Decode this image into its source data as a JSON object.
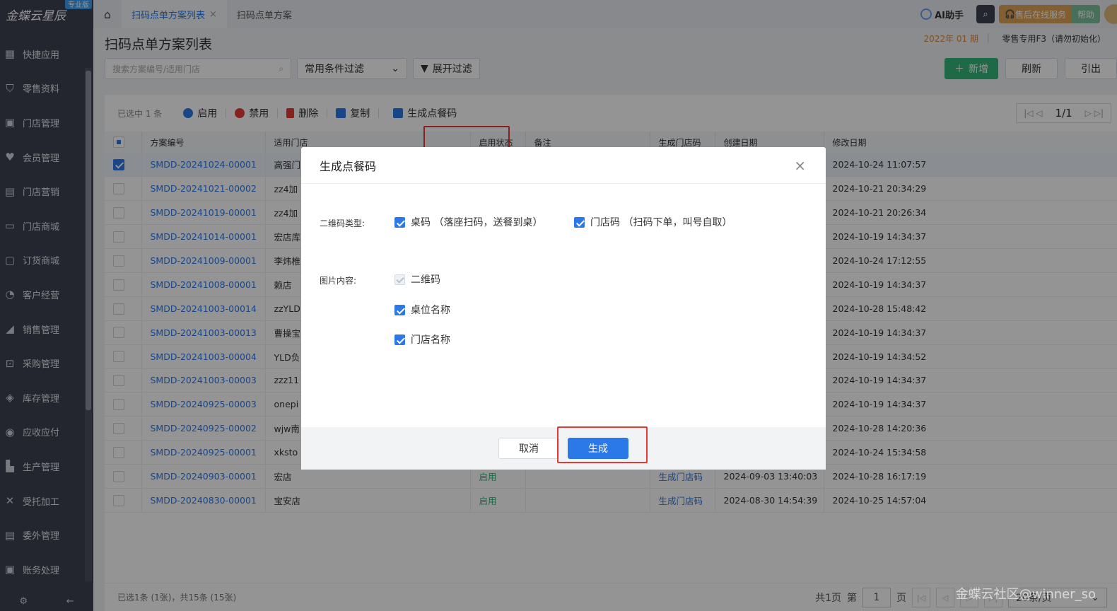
{
  "app": {
    "logo": "金蝶云星辰",
    "edition": "专业版"
  },
  "sidebar": {
    "items": [
      {
        "label": "快捷应用",
        "icon": "grid-icon"
      },
      {
        "label": "零售资料",
        "icon": "basket-icon"
      },
      {
        "label": "门店管理",
        "icon": "store-icon"
      },
      {
        "label": "会员管理",
        "icon": "heart-icon"
      },
      {
        "label": "门店营销",
        "icon": "bag-icon"
      },
      {
        "label": "门店商城",
        "icon": "shop-icon"
      },
      {
        "label": "订货商城",
        "icon": "cart-bag-icon"
      },
      {
        "label": "客户经营",
        "icon": "customer-icon"
      },
      {
        "label": "销售管理",
        "icon": "chart-icon"
      },
      {
        "label": "采购管理",
        "icon": "cart-icon"
      },
      {
        "label": "库存管理",
        "icon": "box-icon"
      },
      {
        "label": "应收应付",
        "icon": "money-icon"
      },
      {
        "label": "生产管理",
        "icon": "factory-icon"
      },
      {
        "label": "受托加工",
        "icon": "tools-icon"
      },
      {
        "label": "委外管理",
        "icon": "outsource-icon"
      },
      {
        "label": "账务处理",
        "icon": "ledger-icon"
      }
    ]
  },
  "topbar": {
    "tabs": [
      {
        "label": "扫码点单方案列表",
        "active": true
      },
      {
        "label": "扫码点单方案",
        "active": false
      }
    ],
    "ai": "AI助手",
    "service": "售后在线服务",
    "help": "帮助"
  },
  "page": {
    "title": "扫码点单方案列表",
    "period": "2022年 01 期",
    "org": "零售专用F3（请勿初始化）",
    "search_placeholder": "搜索方案编号/适用门店",
    "filter_select": "常用条件过滤",
    "expand_filter": "展开过滤",
    "btn_new": "新增",
    "btn_refresh": "刷新",
    "btn_export": "引出"
  },
  "toolbar": {
    "selected": "已选中 1 条",
    "enable": "启用",
    "disable": "禁用",
    "delete": "删除",
    "copy": "复制",
    "generate": "生成点餐码",
    "pager": "1/1"
  },
  "table": {
    "headers": [
      "方案编号",
      "适用门店",
      "启用状态",
      "备注",
      "生成门店码",
      "创建日期",
      "修改日期"
    ],
    "rows": [
      {
        "code": "SMDD-20241024-00001",
        "store": "高强门",
        "status": "",
        "note": "",
        "gen": "",
        "created": "",
        "modified": "2024-10-24 11:07:57",
        "checked": true
      },
      {
        "code": "SMDD-20241021-00002",
        "store": "zz4加",
        "status": "",
        "note": "",
        "gen": "",
        "created": "",
        "modified": "2024-10-21 20:34:29",
        "checked": false
      },
      {
        "code": "SMDD-20241019-00001",
        "store": "zz4加",
        "status": "",
        "note": "",
        "gen": "",
        "created": "",
        "modified": "2024-10-21 20:26:34",
        "checked": false
      },
      {
        "code": "SMDD-20241014-00001",
        "store": "宏店库",
        "status": "",
        "note": "",
        "gen": "",
        "created": "",
        "modified": "2024-10-19 14:34:37",
        "checked": false
      },
      {
        "code": "SMDD-20241009-00001",
        "store": "李炜椎",
        "status": "",
        "note": "",
        "gen": "",
        "created": "",
        "modified": "2024-10-24 17:12:55",
        "checked": false
      },
      {
        "code": "SMDD-20241008-00001",
        "store": "赖店",
        "status": "",
        "note": "",
        "gen": "",
        "created": "",
        "modified": "2024-10-19 14:34:37",
        "checked": false
      },
      {
        "code": "SMDD-20241003-00014",
        "store": "zzYLD",
        "status": "",
        "note": "",
        "gen": "",
        "created": "",
        "modified": "2024-10-28 15:48:42",
        "checked": false
      },
      {
        "code": "SMDD-20241003-00013",
        "store": "曹操宝",
        "status": "",
        "note": "",
        "gen": "",
        "created": "",
        "modified": "2024-10-19 14:34:37",
        "checked": false
      },
      {
        "code": "SMDD-20241003-00004",
        "store": "YLD负",
        "status": "",
        "note": "",
        "gen": "",
        "created": "",
        "modified": "2024-10-19 14:34:52",
        "checked": false
      },
      {
        "code": "SMDD-20241003-00003",
        "store": "zzz11",
        "status": "",
        "note": "",
        "gen": "",
        "created": "",
        "modified": "2024-10-19 14:34:37",
        "checked": false
      },
      {
        "code": "SMDD-20240925-00003",
        "store": "onepi",
        "status": "",
        "note": "",
        "gen": "",
        "created": "",
        "modified": "2024-10-19 14:34:37",
        "checked": false
      },
      {
        "code": "SMDD-20240925-00002",
        "store": "wjw南",
        "status": "",
        "note": "",
        "gen": "",
        "created": "",
        "modified": "2024-10-28 14:20:36",
        "checked": false
      },
      {
        "code": "SMDD-20240925-00001",
        "store": "xksto",
        "status": "",
        "note": "",
        "gen": "",
        "created": "",
        "modified": "2024-10-24 15:34:58",
        "checked": false
      },
      {
        "code": "SMDD-20240903-00001",
        "store": "宏店",
        "status": "启用",
        "note": "",
        "gen": "生成门店码",
        "created": "2024-09-03 13:40:03",
        "modified": "2024-10-28 16:17:19",
        "checked": false
      },
      {
        "code": "SMDD-20240830-00001",
        "store": "宝安店",
        "status": "启用",
        "note": "",
        "gen": "生成门店码",
        "created": "2024-08-30 14:54:39",
        "modified": "2024-10-25 14:57:04",
        "checked": false
      }
    ]
  },
  "footer": {
    "summary": "已选1条 (1张)，共15条 (15张)",
    "total_pages": "共1页",
    "page_prefix": "第",
    "page_value": "1",
    "page_suffix": "页",
    "page_size": "20条/页"
  },
  "modal": {
    "title": "生成点餐码",
    "qr_type_label": "二维码类型:",
    "opt_table": "桌码 （落座扫码，送餐到桌）",
    "opt_store": "门店码 （扫码下单，叫号自取）",
    "content_label": "图片内容:",
    "opt_qr": "二维码",
    "opt_table_name": "桌位名称",
    "opt_store_name": "门店名称",
    "cancel": "取消",
    "generate": "生成"
  },
  "watermark": "金蝶云社区@winner_so",
  "colors": {
    "primary": "#2b79e8",
    "green": "#35b77a",
    "highlight": "#e53935",
    "sidebar": "#3d4350"
  }
}
